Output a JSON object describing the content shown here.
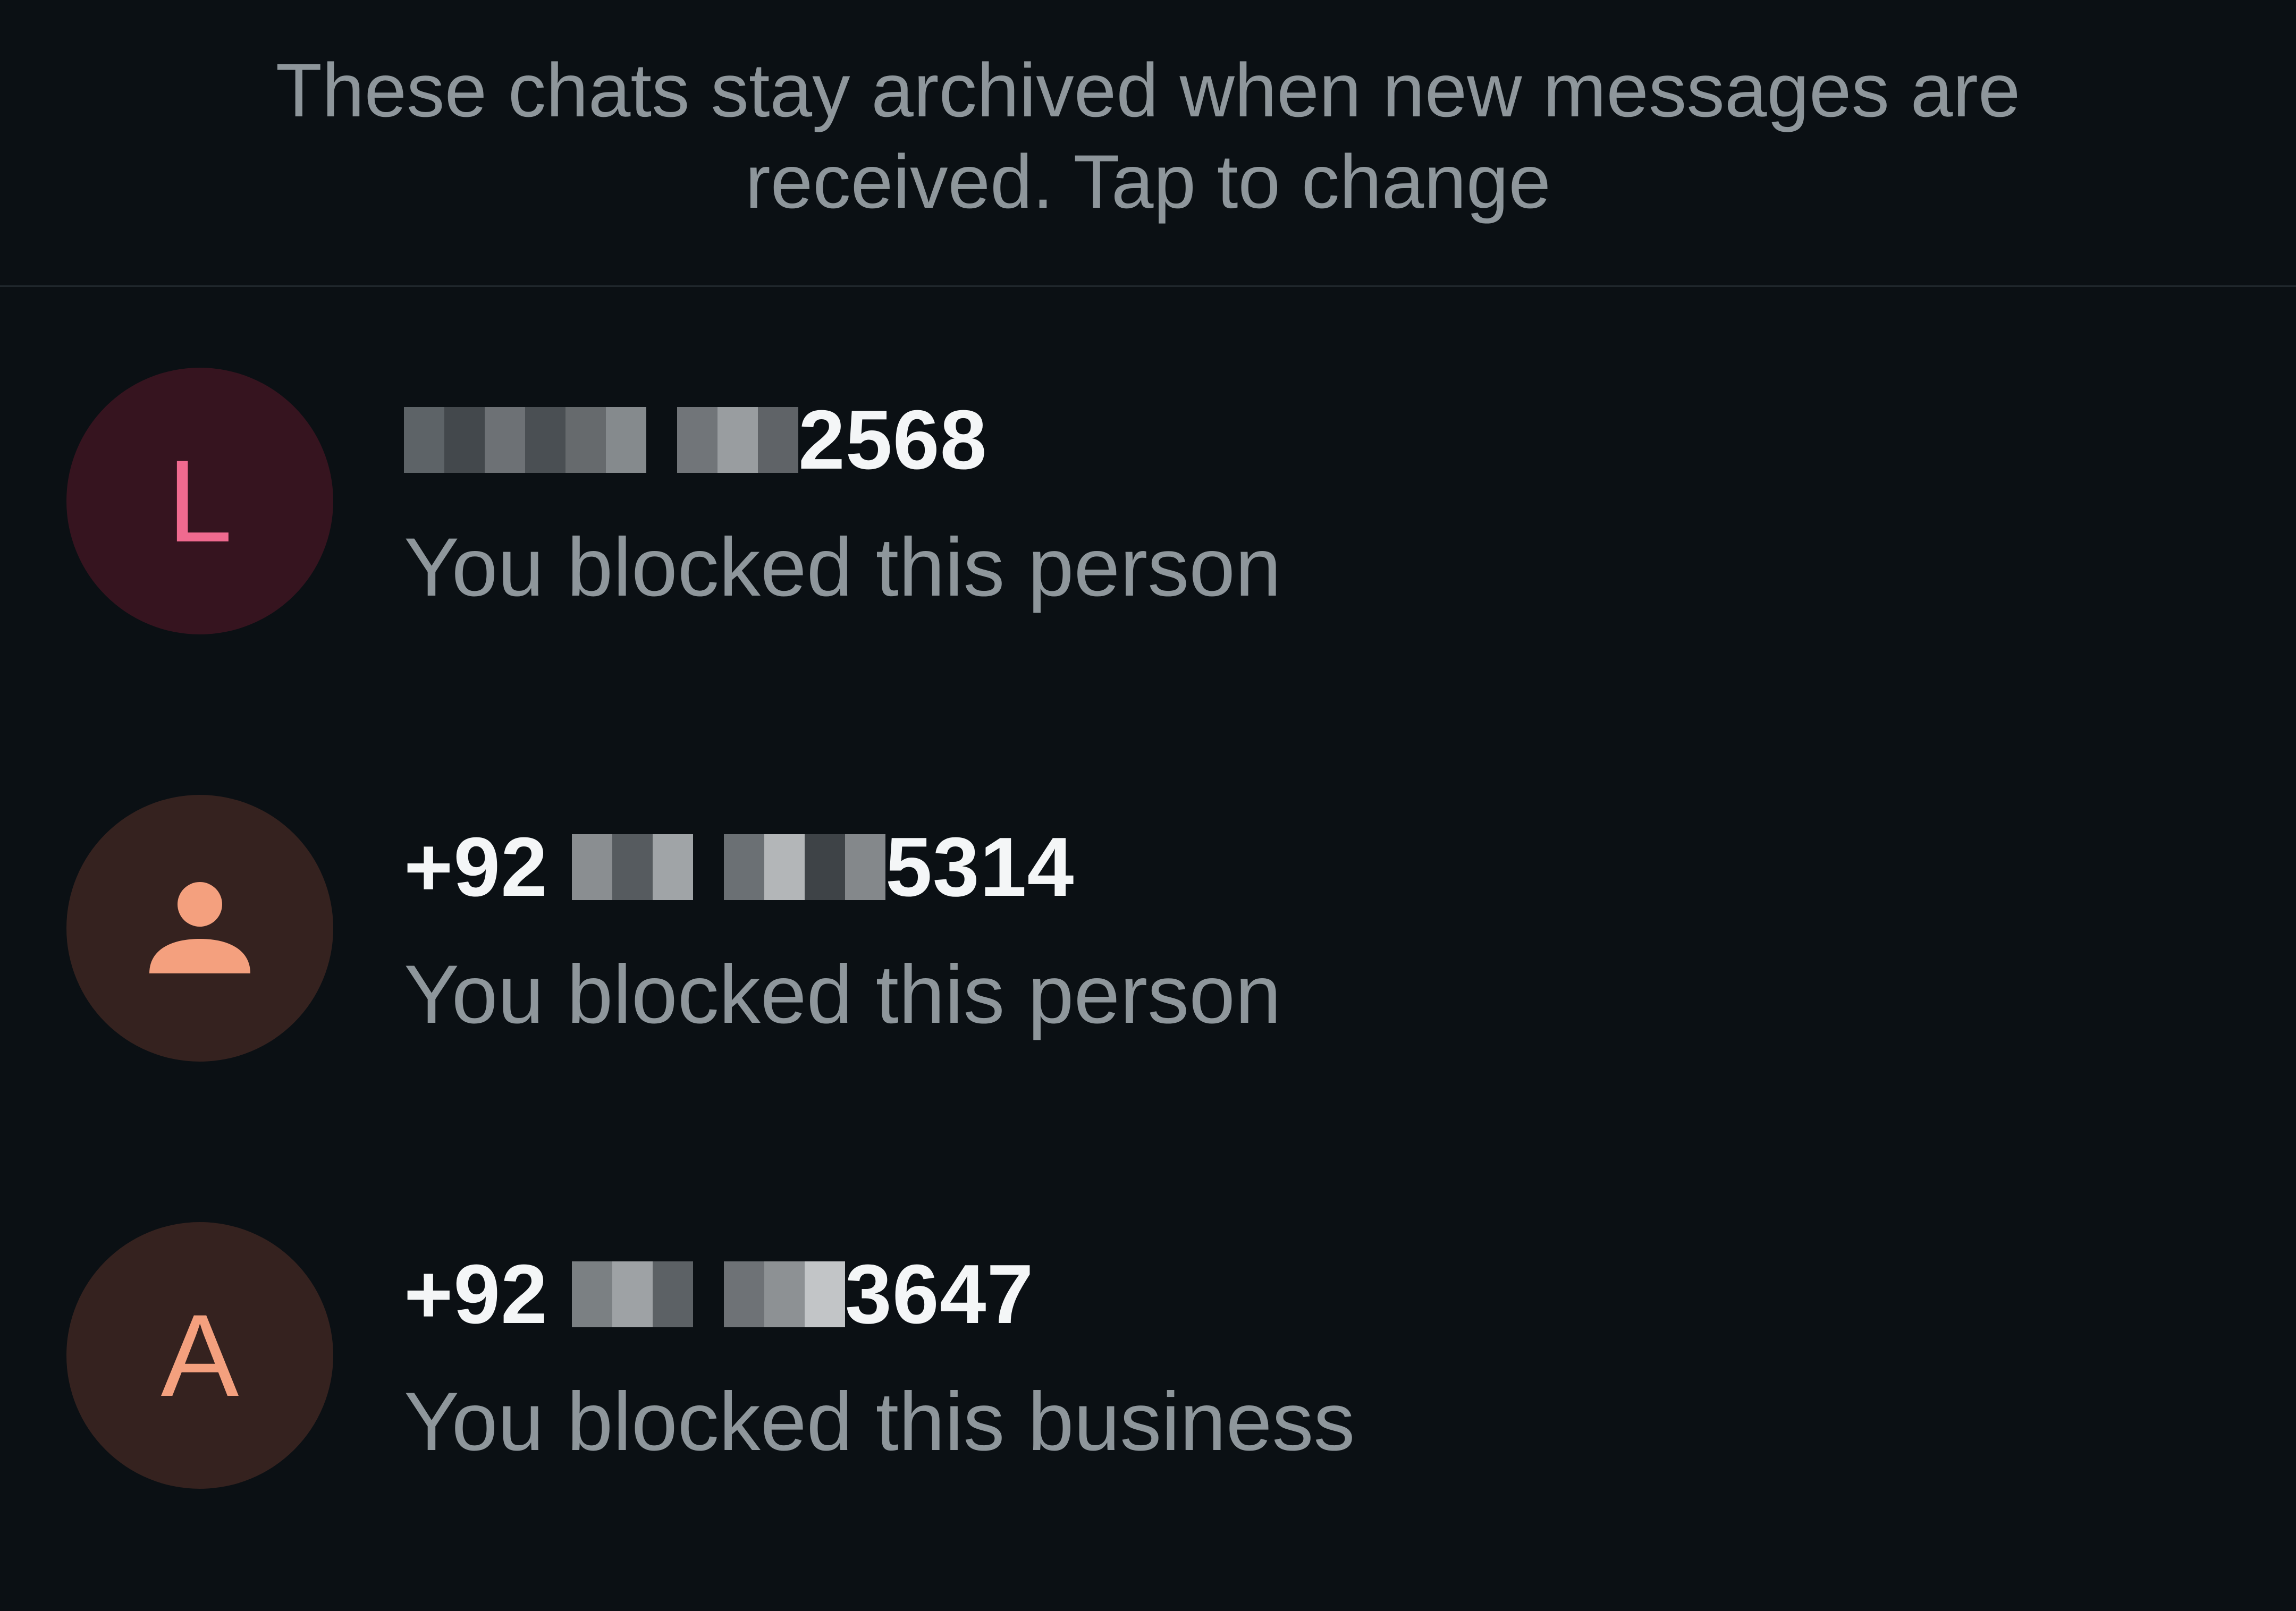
{
  "banner": {
    "text": "These chats stay archived when new messages are received. Tap to change"
  },
  "chats": [
    {
      "avatar_letter": "L",
      "avatar_bg": "#36141f",
      "avatar_fg": "#f06a8f",
      "name_prefix": "",
      "name_suffix": "2568",
      "status": "You blocked this person"
    },
    {
      "avatar_icon": "person-icon",
      "avatar_bg": "#35221f",
      "avatar_fg": "#f4a07e",
      "name_prefix": "+92 ",
      "name_suffix": "5314",
      "status": "You blocked this person"
    },
    {
      "avatar_letter": "A",
      "avatar_bg": "#35221f",
      "avatar_fg": "#f4a07e",
      "name_prefix": "+92 ",
      "name_suffix": "3647",
      "status": "You blocked this business"
    }
  ],
  "colors": {
    "background": "#0b1014",
    "primary_text": "#f4f6f7",
    "secondary_text": "#8e969b",
    "divider": "#20272c"
  }
}
